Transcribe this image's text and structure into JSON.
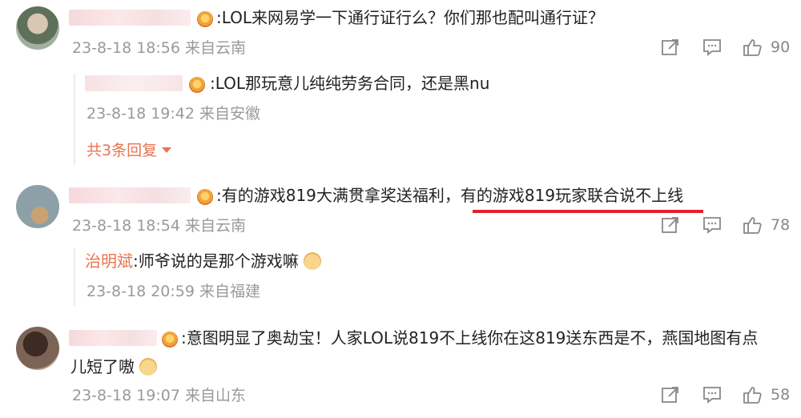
{
  "comments": [
    {
      "text": ":LOL来网易学一下通行证行么？你们那也配叫通行证？",
      "meta": "23-8-18 18:56 来自云南",
      "likes": "90",
      "replies": [
        {
          "text": ":LOL那玩意儿纯纯劳务合同，还是黑nu",
          "meta": "23-8-18 19:42 来自安徽"
        }
      ],
      "reply_link": "共3条回复"
    },
    {
      "text_part1": ":有的游戏819大满贯拿奖送福利，",
      "text_part2": "有的游戏819玩家联合说不上线",
      "meta": "23-8-18 18:54 来自云南",
      "likes": "78",
      "replies": [
        {
          "name": "治明斌",
          "text": ":师爷说的是那个游戏嘛",
          "meta": "23-8-18 20:59 来自福建"
        }
      ]
    },
    {
      "text_line1": ":意图明显了奥劫宝！人家LOL说819不上线你在这819送东西是不，燕国地图有点",
      "text_line2": "儿短了嗷",
      "meta": "23-8-18 19:07 来自山东",
      "likes": "58"
    }
  ],
  "colors": {
    "link": "#eb7350",
    "meta": "#9a9a9a",
    "underline": "#e0222b"
  },
  "icons": [
    "share-icon",
    "comment-icon",
    "like-icon",
    "emoji-icon",
    "caret-down-icon"
  ]
}
